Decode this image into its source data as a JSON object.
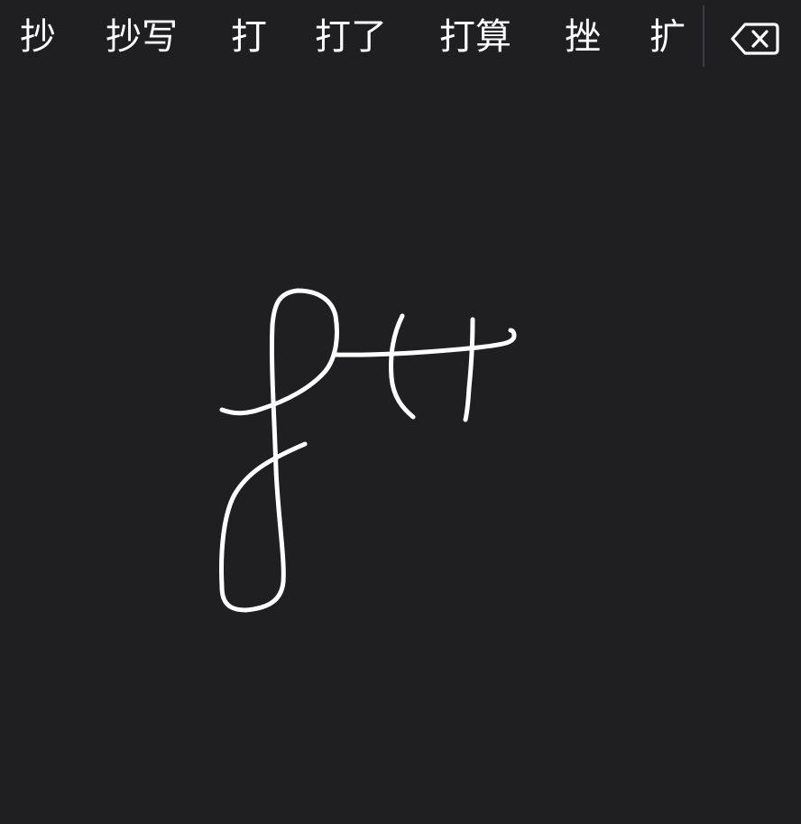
{
  "candidates": [
    "抄",
    "抄写",
    "打",
    "打了",
    "打算",
    "挫",
    "扩"
  ],
  "delete_button": {
    "icon": "backspace-icon"
  },
  "colors": {
    "background": "#1f1e21",
    "text": "#ffffff",
    "ink": "#ffffff",
    "divider": "#3b3a3e"
  }
}
